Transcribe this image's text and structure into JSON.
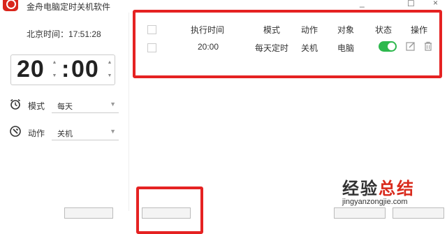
{
  "window": {
    "title": "金舟电脑定时关机软件",
    "controls": [
      "_",
      "☐",
      "×"
    ]
  },
  "sidebar": {
    "clock_label": "北京时间：17:51:28",
    "time": {
      "hour": "20",
      "minute": "00"
    },
    "mode": {
      "label": "模式",
      "value": "每天"
    },
    "action": {
      "label": "动作",
      "value": "关机"
    }
  },
  "table": {
    "headers": [
      "执行时间",
      "模式",
      "动作",
      "对象",
      "状态",
      "操作"
    ],
    "rows": [
      {
        "time": "20:00",
        "mode": "每天定时",
        "action": "关机",
        "target": "电脑",
        "enabled": true
      }
    ]
  },
  "watermark": {
    "main_black": "经验",
    "main_red": "总结",
    "url": "jingyanzongjie.com"
  },
  "colors": {
    "accent_red": "#e52222",
    "toggle_green": "#2db84d"
  }
}
